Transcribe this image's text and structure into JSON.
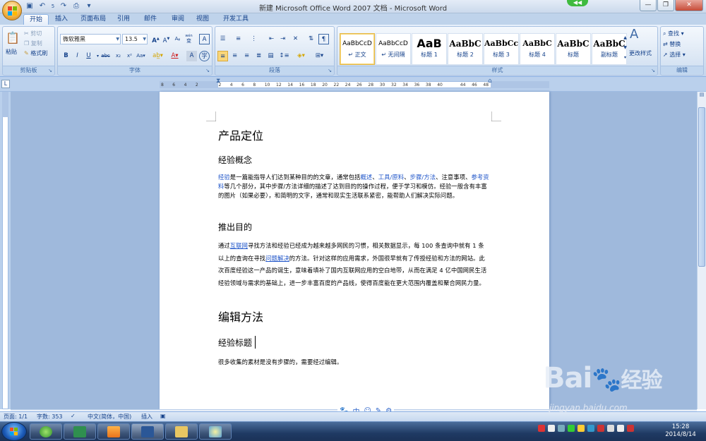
{
  "window": {
    "title": "新建 Microsoft Office Word 2007 文档 - Microsoft Word"
  },
  "qat": {
    "undo_count": "5"
  },
  "tabs": [
    "开始",
    "插入",
    "页面布局",
    "引用",
    "邮件",
    "审阅",
    "视图",
    "开发工具"
  ],
  "ribbon": {
    "clipboard": {
      "label": "剪贴板",
      "paste": "粘贴",
      "cut": "剪切",
      "copy": "复制",
      "format_painter": "格式刷"
    },
    "font": {
      "label": "字体",
      "font_name": "微软雅黑",
      "font_size": "13.5",
      "wen_glyph": "wén",
      "phonetic_char": "变"
    },
    "paragraph": {
      "label": "段落"
    },
    "styles": {
      "label": "样式",
      "items": [
        {
          "sample": "AaBbCcD",
          "name": "↵ 正文"
        },
        {
          "sample": "AaBbCcD",
          "name": "↵ 无间隔"
        },
        {
          "sample": "AaB",
          "name": "标题 1"
        },
        {
          "sample": "AaBbC",
          "name": "标题 2"
        },
        {
          "sample": "AaBbCc",
          "name": "标题 3"
        },
        {
          "sample": "AaBbC",
          "name": "标题 4"
        },
        {
          "sample": "AaBbC",
          "name": "标题"
        },
        {
          "sample": "AaBbC",
          "name": "副标题"
        }
      ],
      "change_styles": "更改样式"
    },
    "editing": {
      "label": "编辑",
      "find": "查找",
      "replace": "替换",
      "select": "选择"
    }
  },
  "ruler": {
    "h_ticks": [
      "8",
      "6",
      "4",
      "2",
      "",
      "2",
      "4",
      "6",
      "8",
      "10",
      "12",
      "14",
      "16",
      "18",
      "20",
      "22",
      "24",
      "26",
      "28",
      "30",
      "32",
      "34",
      "36",
      "38",
      "40",
      "",
      "44",
      "46",
      "48"
    ]
  },
  "document": {
    "h1_product": "产品定位",
    "h2_concept": "经验概念",
    "p_concept": {
      "t1": "经验",
      "t2": "是一篇能指导人们达到某种目的的文章，通常包括",
      "t3": "概述",
      "t4": "、",
      "t5": "工具/原料",
      "t6": "、",
      "t7": "步骤/方法",
      "t8": "、注意事项、",
      "t9": "参考资料",
      "t10": "等几个部分，其中步骤/方法详细的描述了达到目的的操作过程，便于学习和模仿。经验一般含有丰富的图片（如果必要），和简明的文字，通常和现实生活联系紧密，能帮助人们解决实际问题。"
    },
    "h2_purpose": "推出目的",
    "p_purpose": {
      "t1": "通过",
      "t2": "互联网",
      "t3": "寻找方法和经验已经成为越来越多网民的习惯，相关数据显示，每 100 条查询中就有 1 条以上的查询在寻找",
      "t4": "问题解决",
      "t5": "的方法。针对这样的应用需求，外国很早就有了传授经验和方法的网站。此次百度经验这一产品的诞生，意味着填补了国内互联网应用的空白地带，从而在满足 4 亿中国网民生活经验领域与需求的基础上，进一步丰富百度的产品线，使得百度能在更大范围内覆盖和聚合网民力量。"
    },
    "h1_edit": "编辑方法",
    "h2_title": "经验标题",
    "p_title": "很多收集的素材是没有步骤的，需要经过编辑。"
  },
  "status": {
    "page": "页面: 1/1",
    "words": "字数: 353",
    "lang": "中文(简体，中国)",
    "mode": "插入"
  },
  "ime": {
    "mode": "中"
  },
  "clock": {
    "time": "15:28",
    "date": "2014/8/14"
  },
  "watermark": {
    "brand": "Bai",
    "brand2": "经验",
    "url": "jingyan.baidu.com"
  },
  "colors": {
    "ribbon_text": "#15428b",
    "link": "#1f55c9",
    "taskbar": "#1f3a63"
  }
}
